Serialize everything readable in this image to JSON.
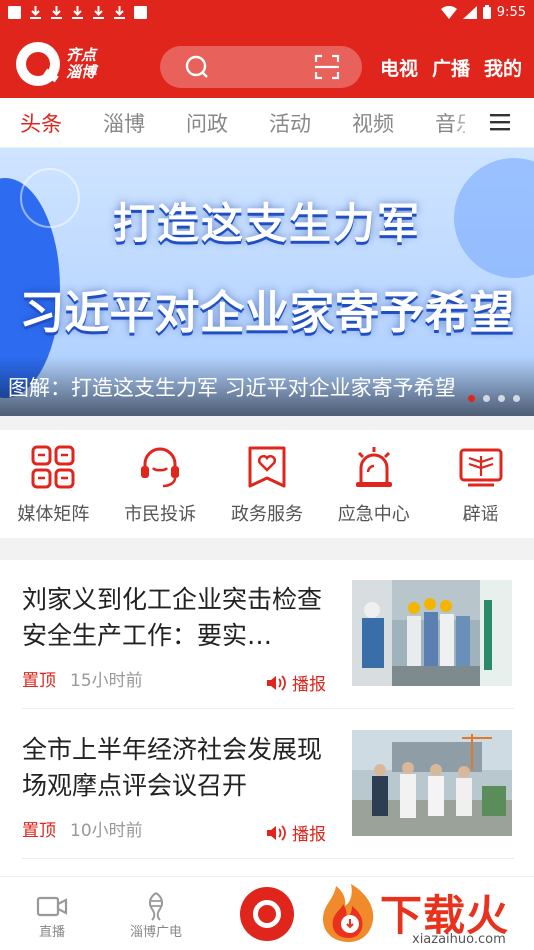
{
  "status_bar": {
    "time": "9:55"
  },
  "header": {
    "logo_line1": "齐点",
    "logo_line2": "淄博",
    "nav": [
      "电视",
      "广播",
      "我的"
    ]
  },
  "tabs": [
    "头条",
    "淄博",
    "问政",
    "活动",
    "视频",
    "音乐"
  ],
  "banner": {
    "headline_line1": "打造这支生力军",
    "headline_line2": "习近平对企业家寄予希望",
    "caption": "图解：打造这支生力军 习近平对企业家寄予希望"
  },
  "services": [
    {
      "label": "媒体矩阵",
      "icon": "grid-icon"
    },
    {
      "label": "市民投诉",
      "icon": "headset-icon"
    },
    {
      "label": "政务服务",
      "icon": "heart-doc-icon"
    },
    {
      "label": "应急中心",
      "icon": "siren-icon"
    },
    {
      "label": "辟谣",
      "icon": "book-icon"
    }
  ],
  "news": [
    {
      "title": "刘家义到化工企业突击检查安全生产工作：要实…",
      "pin": "置顶",
      "time": "15小时前",
      "play": "播报"
    },
    {
      "title": "全市上半年经济社会发展现场观摩点评会议召开",
      "pin": "置顶",
      "time": "10小时前",
      "play": "播报"
    }
  ],
  "bottom_bar": {
    "live": "直播",
    "radio": "淄博广电"
  },
  "watermark": {
    "text": "下载火",
    "url": "xiazaihuo.com"
  },
  "colors": {
    "brand_red": "#e0251c",
    "banner_blue": "#2d6cf0"
  }
}
